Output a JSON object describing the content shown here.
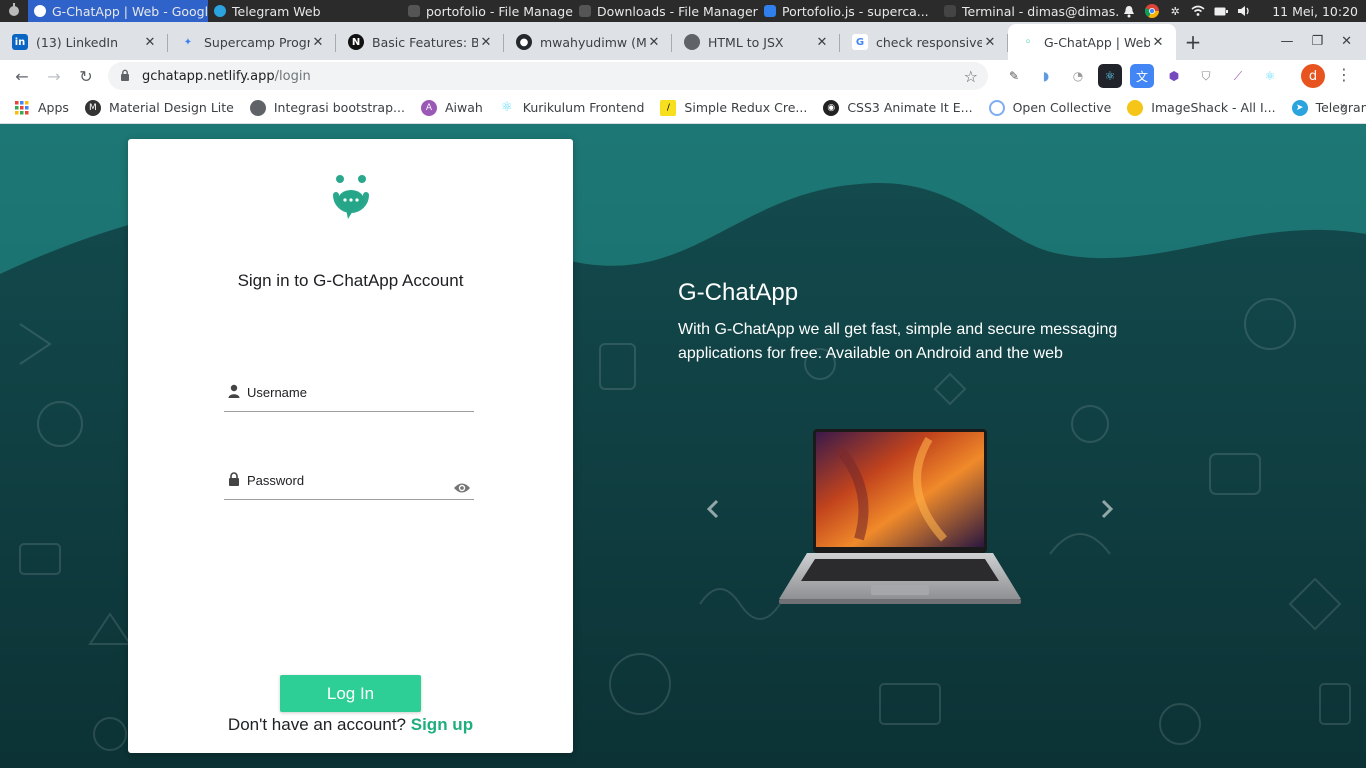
{
  "os_panel": {
    "tasks": [
      {
        "label": "G-ChatApp | Web - Googl...",
        "icon": "chrome-icon",
        "active": true
      },
      {
        "label": "Telegram Web",
        "icon": "telegram-icon",
        "active": false
      },
      {
        "label": "portofolio - File Manager",
        "icon": "folder-icon",
        "active": false
      },
      {
        "label": "Downloads - File Manager",
        "icon": "folder-icon",
        "active": false
      },
      {
        "label": "Portofolio.js - superca...",
        "icon": "vscode-icon",
        "active": false
      },
      {
        "label": "Terminal - dimas@dimas...",
        "icon": "terminal-icon",
        "active": false
      }
    ],
    "clock": "11 Mei, 10:20"
  },
  "tabs": [
    {
      "title": "(13) LinkedIn",
      "icon": "linkedin-icon",
      "color": "#0a66c2"
    },
    {
      "title": "Supercamp Progra",
      "icon": "supercamp-icon",
      "color": "#3b82f6"
    },
    {
      "title": "Basic Features: Bu",
      "icon": "notion-icon",
      "color": "#111111"
    },
    {
      "title": "mwahyudimw (Mul",
      "icon": "github-icon",
      "color": "#24292e"
    },
    {
      "title": "HTML to JSX",
      "icon": "globe-icon",
      "color": "#5f6368"
    },
    {
      "title": "check responsive",
      "icon": "google-icon",
      "color": "#4285f4"
    },
    {
      "title": "G-ChatApp | Web",
      "icon": "gchatapp-icon",
      "color": "#2ecf96",
      "active": true
    }
  ],
  "address": {
    "host": "gchatapp.netlify.app",
    "path": "/login"
  },
  "profile_initial": "d",
  "bookmarks": [
    {
      "label": "Apps",
      "icon": "apps-grid-icon",
      "color": "#ea4335"
    },
    {
      "label": "Material Design Lite",
      "icon": "mdl-icon",
      "color": "#333333"
    },
    {
      "label": "Integrasi bootstrap...",
      "icon": "globe-icon",
      "color": "#5f6368"
    },
    {
      "label": "Aiwah",
      "icon": "aiwah-icon",
      "color": "#9b59b6"
    },
    {
      "label": "Kurikulum Frontend",
      "icon": "react-icon",
      "color": "#61dafb"
    },
    {
      "label": "Simple Redux Cre...",
      "icon": "redux-icon",
      "color": "#f7df1e"
    },
    {
      "label": "CSS3 Animate It E...",
      "icon": "ninja-icon",
      "color": "#222222"
    },
    {
      "label": "Open Collective",
      "icon": "opencollective-icon",
      "color": "#7fadf2"
    },
    {
      "label": "ImageShack - All I...",
      "icon": "imageshack-icon",
      "color": "#f5c518"
    },
    {
      "label": "Telegram Web",
      "icon": "telegram-icon",
      "color": "#2aa3df"
    }
  ],
  "login": {
    "title": "Sign in to G-ChatApp Account",
    "username_placeholder": "Username",
    "password_placeholder": "Password",
    "login_button": "Log In",
    "no_account_text": "Don't have an account?",
    "signup_link": "Sign up"
  },
  "hero": {
    "title": "G-ChatApp",
    "subtitle": "With G-ChatApp we all get fast, simple and secure messaging applications for free. Available on Android and the web"
  },
  "colors": {
    "brand": "#2ecf96",
    "teal_dark": "#0f3d40",
    "teal_light": "#1a7170"
  }
}
